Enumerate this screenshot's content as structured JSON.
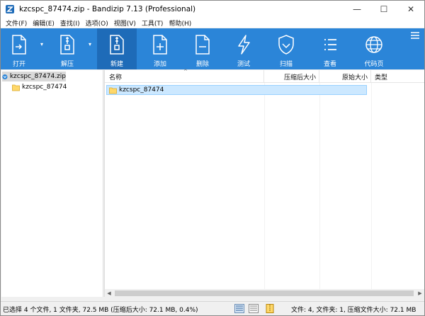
{
  "window": {
    "title": "kzcspc_87474.zip - Bandizip 7.13 (Professional)",
    "controls": [
      "—",
      "☐",
      "✕"
    ]
  },
  "menu": [
    "文件(F)",
    "编辑(E)",
    "查找(I)",
    "选项(O)",
    "视图(V)",
    "工具(T)",
    "帮助(H)"
  ],
  "toolbar": {
    "open": "打开",
    "extract": "解压",
    "new": "新建",
    "add": "添加",
    "delete": "删除",
    "test": "测试",
    "scan": "扫描",
    "view": "查看",
    "codepage": "代码页"
  },
  "tree": {
    "root": "kzcspc_87474.zip",
    "child": "kzcspc_87474"
  },
  "list": {
    "columns": [
      "名称",
      "压缩后大小",
      "原始大小",
      "类型"
    ],
    "rows": [
      {
        "name": "kzcspc_87474"
      }
    ]
  },
  "status": {
    "left": "已选择 4 个文件, 1 文件夹, 72.5 MB (压缩后大小: 72.1 MB, 0.4%)",
    "right": "文件: 4, 文件夹: 1, 压缩文件大小: 72.1 MB"
  },
  "colors": {
    "toolbar": "#2b85d8",
    "toolbar_active": "#1e6bb8",
    "selection": "#cce8ff"
  }
}
